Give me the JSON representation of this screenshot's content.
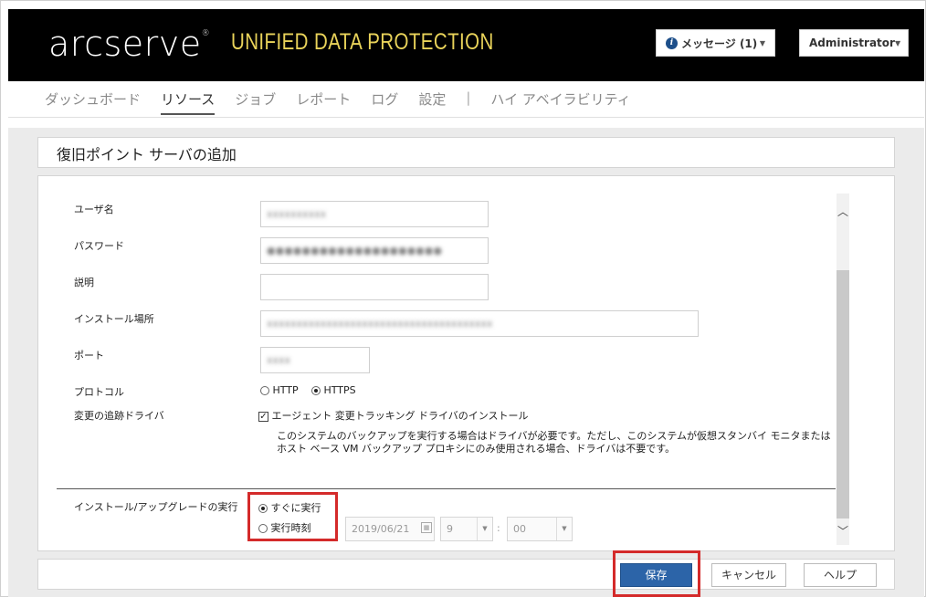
{
  "header": {
    "logo_text": "arcserve",
    "logo_mark": "®",
    "product": "UNIFIED DATA PROTECTION",
    "messages_label": "メッセージ (1)",
    "admin_label": "Administrator"
  },
  "nav": {
    "items": [
      "ダッシュボード",
      "リソース",
      "ジョブ",
      "レポート",
      "ログ",
      "設定"
    ],
    "separator": "|",
    "ha": "ハイ アベイラビリティ",
    "active": "リソース"
  },
  "page_title": "復旧ポイント サーバの追加",
  "form": {
    "username_label": "ユーザ名",
    "username_value": "xxxxxxxxxx",
    "password_label": "パスワード",
    "password_value": "●●●●●●●●●●●●●●●●●●●●",
    "description_label": "説明",
    "description_value": "",
    "install_path_label": "インストール場所",
    "install_path_value": "xxxxxxxxxxxxxxxxxxxxxxxxxxxxxxxxxxxxxx",
    "port_label": "ポート",
    "port_value": "xxxx",
    "protocol_label": "プロトコル",
    "protocol_http": "HTTP",
    "protocol_https": "HTTPS",
    "protocol_selected": "HTTPS",
    "driver_label": "変更の追跡ドライバ",
    "driver_checkbox": "エージェント 変更トラッキング ドライバのインストール",
    "driver_checked": true,
    "driver_desc": "このシステムのバックアップを実行する場合はドライバが必要です。ただし、このシステムが仮想スタンバイ モニタまたはホスト ベース VM バックアップ プロキシにのみ使用される場合、ドライバは不要です。",
    "run_label": "インストール/アップグレードの実行",
    "run_now": "すぐに実行",
    "run_scheduled": "実行時刻",
    "run_selected": "すぐに実行",
    "date_value": "2019/06/21",
    "hour_value": "9",
    "minute_value": "00",
    "time_sep": ":"
  },
  "buttons": {
    "save": "保存",
    "cancel": "キャンセル",
    "help": "ヘルプ"
  },
  "colors": {
    "header_bg": "#000000",
    "product_text": "#e9d35a",
    "save_bg": "#2c64a8",
    "highlight": "#d42a2a"
  }
}
